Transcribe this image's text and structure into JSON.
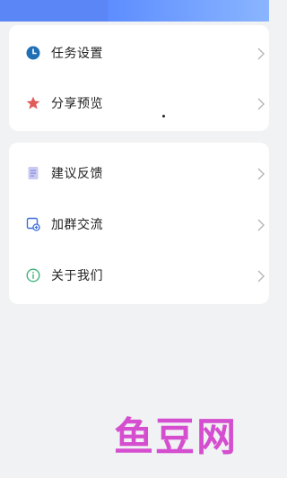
{
  "menu_group_1": {
    "items": [
      {
        "label": "任务设置",
        "icon": "clock-icon"
      },
      {
        "label": "分享预览",
        "icon": "star-icon"
      }
    ]
  },
  "menu_group_2": {
    "items": [
      {
        "label": "建议反馈",
        "icon": "document-icon"
      },
      {
        "label": "加群交流",
        "icon": "group-chat-icon"
      },
      {
        "label": "关于我们",
        "icon": "info-icon"
      }
    ]
  },
  "watermark": {
    "text": "鱼豆网"
  },
  "colors": {
    "accent_blue": "#4a7dff",
    "clock_icon": "#1f6fb5",
    "star_icon": "#e15b5b",
    "doc_icon": "#8f8fe0",
    "group_icon": "#3a6fd8",
    "info_icon": "#3db27a",
    "watermark": "#d44ecf"
  }
}
